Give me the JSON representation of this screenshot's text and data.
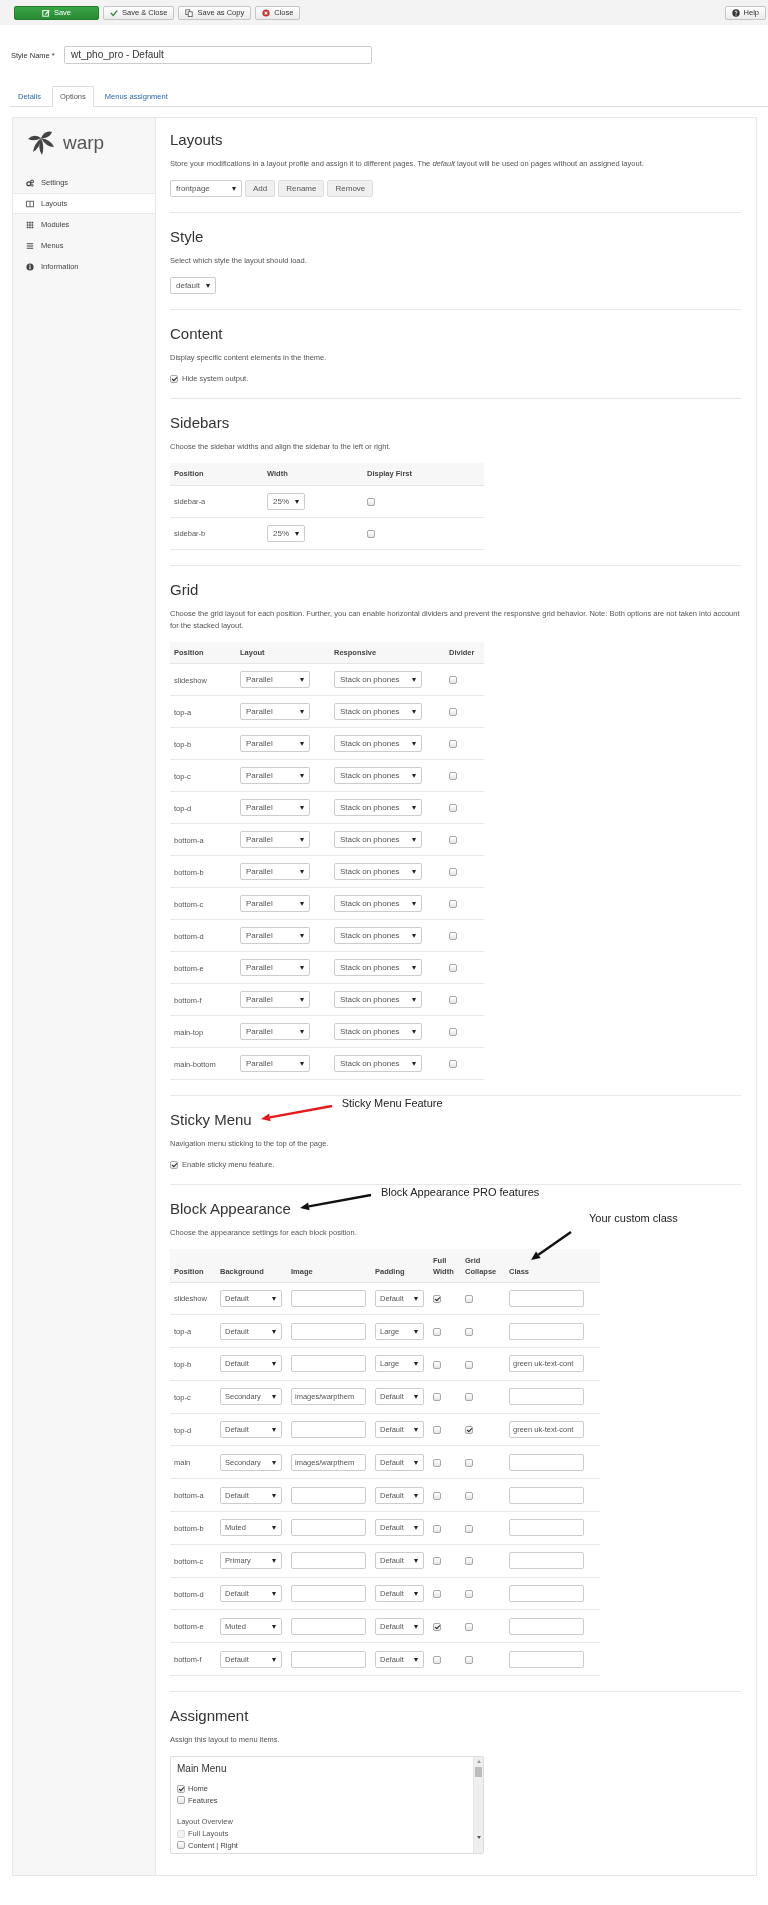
{
  "toolbar": {
    "buttons": [
      {
        "label": "Save",
        "kind": "primary"
      },
      {
        "label": "Save & Close",
        "kind": "default"
      },
      {
        "label": "Save as Copy",
        "kind": "default"
      },
      {
        "label": "Close",
        "kind": "default"
      }
    ],
    "help_button": {
      "label": "Help"
    }
  },
  "style_name": {
    "label": "Style Name *",
    "value": "wt_pho_pro - Default"
  },
  "tabs": [
    {
      "label": "Details",
      "selected": false
    },
    {
      "label": "Options",
      "selected": true
    },
    {
      "label": "Menus assignment",
      "selected": false
    }
  ],
  "sidebar": {
    "logo": "warp",
    "items": [
      {
        "label": "Settings",
        "selected": false
      },
      {
        "label": "Layouts",
        "selected": true
      },
      {
        "label": "Modules",
        "selected": false
      },
      {
        "label": "Menus",
        "selected": false
      },
      {
        "label": "Information",
        "selected": false
      }
    ]
  },
  "sections": [
    {
      "kind": "profile",
      "title": "Layouts",
      "description": "Store your modifications in a layout profile and assign it to different pages. The *default* layout will be used on pages without an assigned layout.",
      "select": "frontpage",
      "buttons": [
        "Add",
        "Rename",
        "Remove"
      ]
    },
    {
      "kind": "select",
      "title": "Style",
      "description": "Select which style the layout should load.",
      "select": "default"
    },
    {
      "kind": "checkbox",
      "title": "Content",
      "description": "Display specific content elements in the theme.",
      "checkbox": {
        "label": "Hide system output.",
        "checked": true
      }
    },
    {
      "kind": "table",
      "title": "Sidebars",
      "description": "Choose the sidebar widths and align the sidebar to the left or right.",
      "table": {
        "columns": [
          {
            "label": "Position"
          },
          {
            "label": "Width"
          },
          {
            "label": "Display First"
          }
        ],
        "rows": [
          {
            "cells": [
              {
                "kind": "text",
                "text": "sidebar-a"
              },
              {
                "kind": "select",
                "value": "25%"
              },
              {
                "kind": "checkbox",
                "checked": false
              }
            ]
          },
          {
            "cells": [
              {
                "kind": "text",
                "text": "sidebar-b"
              },
              {
                "kind": "select",
                "value": "25%"
              },
              {
                "kind": "checkbox",
                "checked": false
              }
            ]
          }
        ]
      }
    },
    {
      "kind": "table",
      "title": "Grid",
      "description": "Choose the grid layout for each position. Further, you can enable horizontal dividers and prevent the responsive grid behavior. Note: Both options are not taken into account for the stacked layout.",
      "table": {
        "columns": [
          {
            "label": "Position"
          },
          {
            "label": "Layout"
          },
          {
            "label": "Responsive"
          },
          {
            "label": "Divider"
          }
        ],
        "rows": [
          {
            "cells": [
              {
                "kind": "text",
                "text": "slideshow"
              },
              {
                "kind": "select",
                "value": "Parallel"
              },
              {
                "kind": "select",
                "value": "Stack on phones"
              },
              {
                "kind": "checkbox",
                "checked": false
              }
            ]
          },
          {
            "cells": [
              {
                "kind": "text",
                "text": "top-a"
              },
              {
                "kind": "select",
                "value": "Parallel"
              },
              {
                "kind": "select",
                "value": "Stack on phones"
              },
              {
                "kind": "checkbox",
                "checked": false
              }
            ]
          },
          {
            "cells": [
              {
                "kind": "text",
                "text": "top-b"
              },
              {
                "kind": "select",
                "value": "Parallel"
              },
              {
                "kind": "select",
                "value": "Stack on phones"
              },
              {
                "kind": "checkbox",
                "checked": false
              }
            ]
          },
          {
            "cells": [
              {
                "kind": "text",
                "text": "top-c"
              },
              {
                "kind": "select",
                "value": "Parallel"
              },
              {
                "kind": "select",
                "value": "Stack on phones"
              },
              {
                "kind": "checkbox",
                "checked": false
              }
            ]
          },
          {
            "cells": [
              {
                "kind": "text",
                "text": "top-d"
              },
              {
                "kind": "select",
                "value": "Parallel"
              },
              {
                "kind": "select",
                "value": "Stack on phones"
              },
              {
                "kind": "checkbox",
                "checked": false
              }
            ]
          },
          {
            "cells": [
              {
                "kind": "text",
                "text": "bottom-a"
              },
              {
                "kind": "select",
                "value": "Parallel"
              },
              {
                "kind": "select",
                "value": "Stack on phones"
              },
              {
                "kind": "checkbox",
                "checked": false
              }
            ]
          },
          {
            "cells": [
              {
                "kind": "text",
                "text": "bottom-b"
              },
              {
                "kind": "select",
                "value": "Parallel"
              },
              {
                "kind": "select",
                "value": "Stack on phones"
              },
              {
                "kind": "checkbox",
                "checked": false
              }
            ]
          },
          {
            "cells": [
              {
                "kind": "text",
                "text": "bottom-c"
              },
              {
                "kind": "select",
                "value": "Parallel"
              },
              {
                "kind": "select",
                "value": "Stack on phones"
              },
              {
                "kind": "checkbox",
                "checked": false
              }
            ]
          },
          {
            "cells": [
              {
                "kind": "text",
                "text": "bottom-d"
              },
              {
                "kind": "select",
                "value": "Parallel"
              },
              {
                "kind": "select",
                "value": "Stack on phones"
              },
              {
                "kind": "checkbox",
                "checked": false
              }
            ]
          },
          {
            "cells": [
              {
                "kind": "text",
                "text": "bottom-e"
              },
              {
                "kind": "select",
                "value": "Parallel"
              },
              {
                "kind": "select",
                "value": "Stack on phones"
              },
              {
                "kind": "checkbox",
                "checked": false
              }
            ]
          },
          {
            "cells": [
              {
                "kind": "text",
                "text": "bottom-f"
              },
              {
                "kind": "select",
                "value": "Parallel"
              },
              {
                "kind": "select",
                "value": "Stack on phones"
              },
              {
                "kind": "checkbox",
                "checked": false
              }
            ]
          },
          {
            "cells": [
              {
                "kind": "text",
                "text": "main-top"
              },
              {
                "kind": "select",
                "value": "Parallel"
              },
              {
                "kind": "select",
                "value": "Stack on phones"
              },
              {
                "kind": "checkbox",
                "checked": false
              }
            ]
          },
          {
            "cells": [
              {
                "kind": "text",
                "text": "main-bottom"
              },
              {
                "kind": "select",
                "value": "Parallel"
              },
              {
                "kind": "select",
                "value": "Stack on phones"
              },
              {
                "kind": "checkbox",
                "checked": false
              }
            ]
          }
        ]
      }
    },
    {
      "kind": "checkbox",
      "title": "Sticky Menu",
      "description": "Navigation menu sticking to the top of the page.",
      "checkbox": {
        "label": "Enable sticky menu feature.",
        "checked": true
      },
      "annotation": {
        "text": "Sticky Menu Feature",
        "color": "#e8191c"
      }
    },
    {
      "kind": "table",
      "title": "Block Appearance",
      "description": "Choose the appearance settings for each block position.",
      "annotation": {
        "text": "Block Appearance PRO features",
        "color": "#111111"
      },
      "table": {
        "columns": [
          {
            "label": "Position"
          },
          {
            "label": "Background"
          },
          {
            "label": "Image"
          },
          {
            "label": "Padding"
          },
          {
            "label": "Full Width"
          },
          {
            "label": "Grid Collapse"
          },
          {
            "label": "Class",
            "annotation": {
              "text": "Your custom class",
              "color": "#111111"
            }
          }
        ],
        "rows": [
          {
            "cells": [
              {
                "kind": "text",
                "text": "slideshow"
              },
              {
                "kind": "select",
                "value": "Default"
              },
              {
                "kind": "field"
              },
              {
                "kind": "select",
                "value": "Default"
              },
              {
                "kind": "checkbox",
                "checked": true
              },
              {
                "kind": "checkbox",
                "checked": false
              },
              {
                "kind": "field"
              }
            ]
          },
          {
            "cells": [
              {
                "kind": "text",
                "text": "top-a"
              },
              {
                "kind": "select",
                "value": "Default"
              },
              {
                "kind": "field"
              },
              {
                "kind": "select",
                "value": "Large"
              },
              {
                "kind": "checkbox",
                "checked": false
              },
              {
                "kind": "checkbox",
                "checked": false
              },
              {
                "kind": "field"
              }
            ]
          },
          {
            "cells": [
              {
                "kind": "text",
                "text": "top-b"
              },
              {
                "kind": "select",
                "value": "Default"
              },
              {
                "kind": "field"
              },
              {
                "kind": "select",
                "value": "Large"
              },
              {
                "kind": "checkbox",
                "checked": false
              },
              {
                "kind": "checkbox",
                "checked": false
              },
              {
                "kind": "field",
                "value": "green uk-text-cont"
              }
            ]
          },
          {
            "cells": [
              {
                "kind": "text",
                "text": "top-c"
              },
              {
                "kind": "select",
                "value": "Secondary"
              },
              {
                "kind": "field",
                "value": "images/warpthem"
              },
              {
                "kind": "select",
                "value": "Default"
              },
              {
                "kind": "checkbox",
                "checked": false
              },
              {
                "kind": "checkbox",
                "checked": false
              },
              {
                "kind": "field"
              }
            ]
          },
          {
            "cells": [
              {
                "kind": "text",
                "text": "top-d"
              },
              {
                "kind": "select",
                "value": "Default"
              },
              {
                "kind": "field"
              },
              {
                "kind": "select",
                "value": "Default"
              },
              {
                "kind": "checkbox",
                "checked": false
              },
              {
                "kind": "checkbox",
                "checked": true
              },
              {
                "kind": "field",
                "value": "green uk-text-cont"
              }
            ]
          },
          {
            "cells": [
              {
                "kind": "text",
                "text": "main"
              },
              {
                "kind": "select",
                "value": "Secondary"
              },
              {
                "kind": "field",
                "value": "images/warpthem"
              },
              {
                "kind": "select",
                "value": "Default"
              },
              {
                "kind": "checkbox",
                "checked": false
              },
              {
                "kind": "checkbox",
                "checked": false
              },
              {
                "kind": "field"
              }
            ]
          },
          {
            "cells": [
              {
                "kind": "text",
                "text": "bottom-a"
              },
              {
                "kind": "select",
                "value": "Default"
              },
              {
                "kind": "field"
              },
              {
                "kind": "select",
                "value": "Default"
              },
              {
                "kind": "checkbox",
                "checked": false
              },
              {
                "kind": "checkbox",
                "checked": false
              },
              {
                "kind": "field"
              }
            ]
          },
          {
            "cells": [
              {
                "kind": "text",
                "text": "bottom-b"
              },
              {
                "kind": "select",
                "value": "Muted"
              },
              {
                "kind": "field"
              },
              {
                "kind": "select",
                "value": "Default"
              },
              {
                "kind": "checkbox",
                "checked": false
              },
              {
                "kind": "checkbox",
                "checked": false
              },
              {
                "kind": "field"
              }
            ]
          },
          {
            "cells": [
              {
                "kind": "text",
                "text": "bottom-c"
              },
              {
                "kind": "select",
                "value": "Primary"
              },
              {
                "kind": "field"
              },
              {
                "kind": "select",
                "value": "Default"
              },
              {
                "kind": "checkbox",
                "checked": false
              },
              {
                "kind": "checkbox",
                "checked": false
              },
              {
                "kind": "field"
              }
            ]
          },
          {
            "cells": [
              {
                "kind": "text",
                "text": "bottom-d"
              },
              {
                "kind": "select",
                "value": "Default"
              },
              {
                "kind": "field"
              },
              {
                "kind": "select",
                "value": "Default"
              },
              {
                "kind": "checkbox",
                "checked": false
              },
              {
                "kind": "checkbox",
                "checked": false
              },
              {
                "kind": "field"
              }
            ]
          },
          {
            "cells": [
              {
                "kind": "text",
                "text": "bottom-e"
              },
              {
                "kind": "select",
                "value": "Muted"
              },
              {
                "kind": "field"
              },
              {
                "kind": "select",
                "value": "Default"
              },
              {
                "kind": "checkbox",
                "checked": true
              },
              {
                "kind": "checkbox",
                "checked": false
              },
              {
                "kind": "field"
              }
            ]
          },
          {
            "cells": [
              {
                "kind": "text",
                "text": "bottom-f"
              },
              {
                "kind": "select",
                "value": "Default"
              },
              {
                "kind": "field"
              },
              {
                "kind": "select",
                "value": "Default"
              },
              {
                "kind": "checkbox",
                "checked": false
              },
              {
                "kind": "checkbox",
                "checked": false
              },
              {
                "kind": "field"
              }
            ]
          }
        ]
      }
    },
    {
      "kind": "assignment",
      "title": "Assignment",
      "description": "Assign this layout to menu items.",
      "box": {
        "title": "Main Menu",
        "items": [
          {
            "kind": "check",
            "label": "Home",
            "checked": true,
            "disabled": false
          },
          {
            "kind": "check",
            "label": "Features",
            "checked": false,
            "disabled": false
          },
          {
            "kind": "group",
            "label": "Layout Overview"
          },
          {
            "kind": "check",
            "label": "Full Layouts",
            "checked": false,
            "disabled": true
          },
          {
            "kind": "check",
            "label": "Content | Right",
            "checked": false,
            "disabled": false
          }
        ]
      }
    }
  ]
}
